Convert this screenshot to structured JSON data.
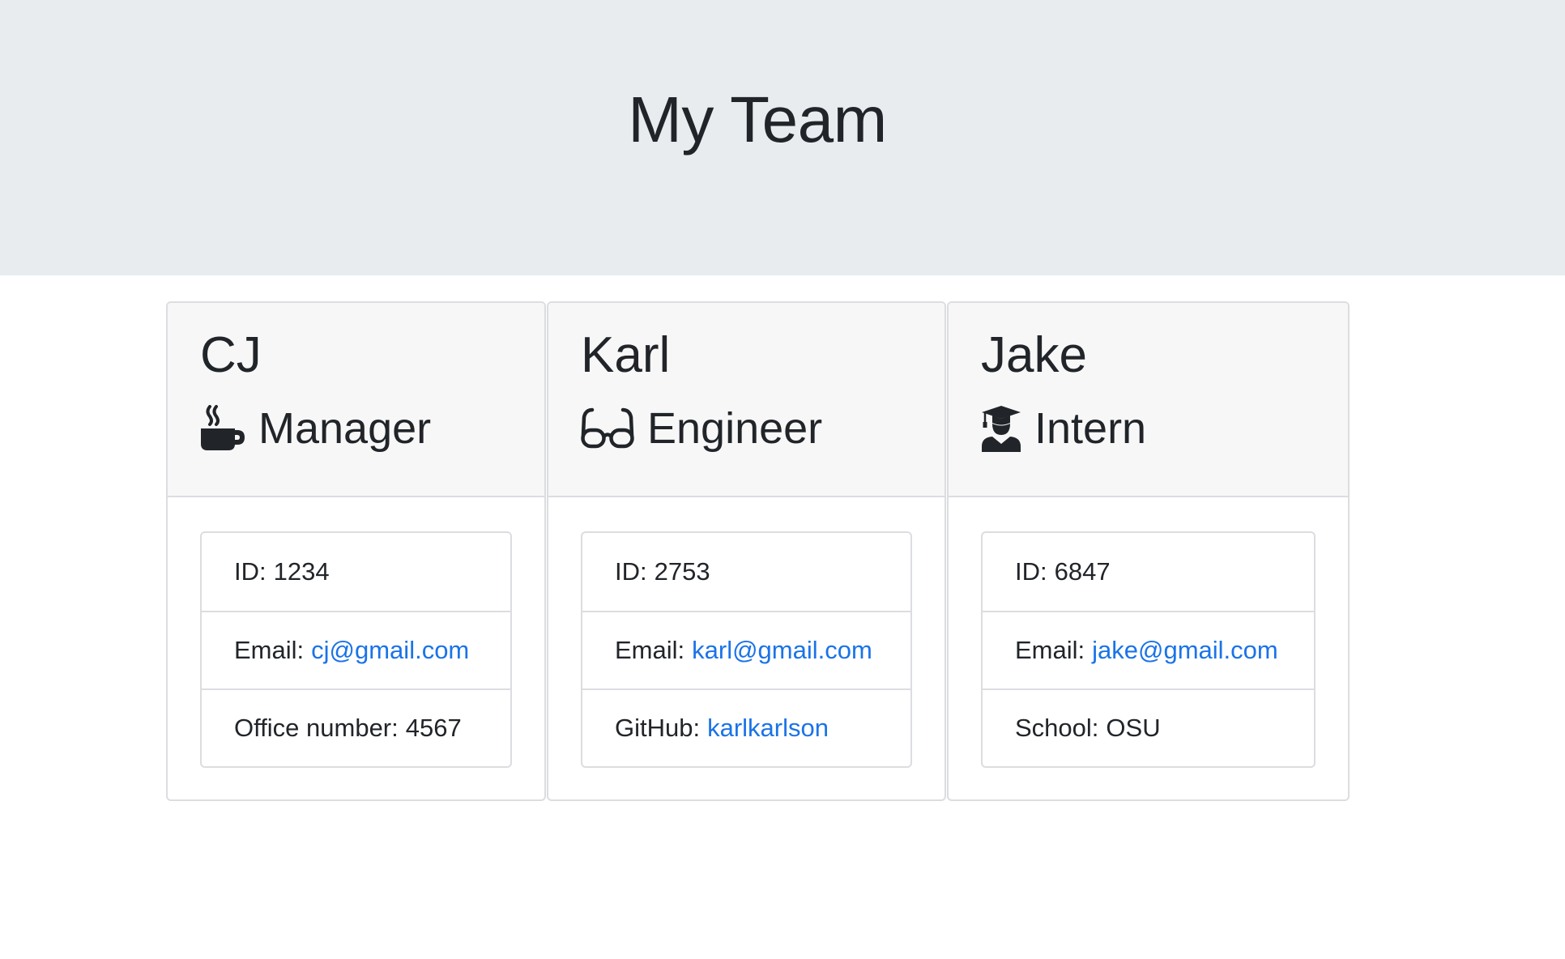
{
  "header": {
    "title": "My Team"
  },
  "team": [
    {
      "name": "CJ",
      "role": "Manager",
      "role_icon": "coffee-mug-icon",
      "id_label": "ID:",
      "id": "1234",
      "email_label": "Email:",
      "email": "cj@gmail.com",
      "extra_label": "Office number:",
      "extra_value": "4567",
      "extra_is_link": false
    },
    {
      "name": "Karl",
      "role": "Engineer",
      "role_icon": "glasses-icon",
      "id_label": "ID:",
      "id": "2753",
      "email_label": "Email:",
      "email": "karl@gmail.com",
      "extra_label": "GitHub:",
      "extra_value": "karlkarlson",
      "extra_is_link": true
    },
    {
      "name": "Jake",
      "role": "Intern",
      "role_icon": "graduate-icon",
      "id_label": "ID:",
      "id": "6847",
      "email_label": "Email:",
      "email": "jake@gmail.com",
      "extra_label": "School:",
      "extra_value": "OSU",
      "extra_is_link": false
    }
  ],
  "colors": {
    "header_bg": "#e9ecef",
    "link": "#1a73e8",
    "text": "#212529"
  }
}
